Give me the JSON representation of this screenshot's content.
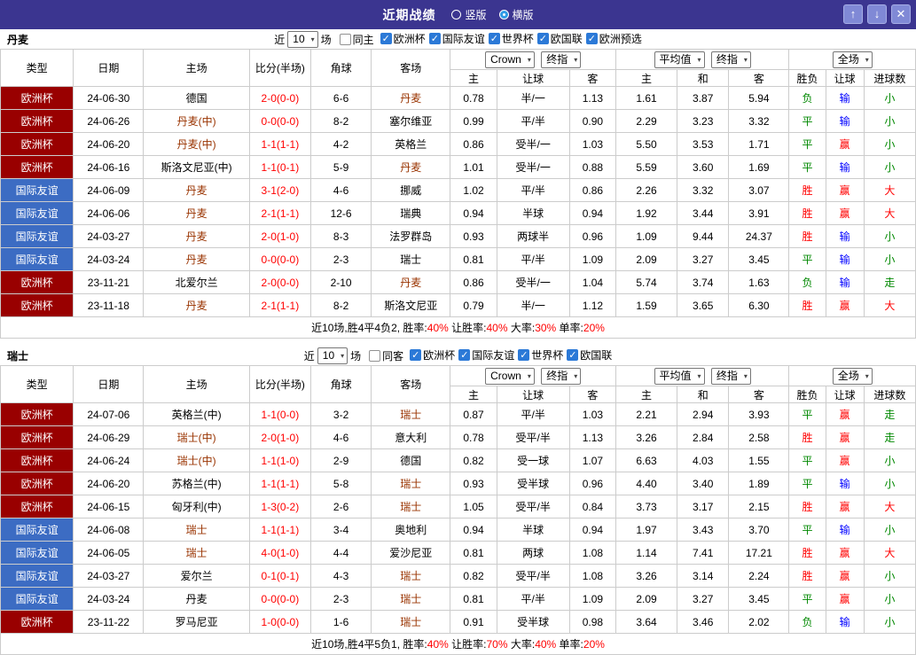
{
  "titlebar": {
    "title": "近期战绩",
    "view_options": [
      {
        "label": "竖版",
        "selected": false
      },
      {
        "label": "横版",
        "selected": true
      }
    ],
    "buttons": {
      "up": "↑",
      "down": "↓",
      "close": "✕"
    }
  },
  "icons": {
    "chevron": "▾"
  },
  "colors": {
    "titlebar_bg": "#3b3590",
    "euro_bg": "#990000",
    "friendly_bg": "#3c6cc3",
    "score": "#ff0000",
    "team_highlight": "#993300",
    "win": "#ff0000",
    "draw": "#008800",
    "loss": "#008800",
    "cover": "#ff0000",
    "not_cover": "#0000ff",
    "over": "#ff0000",
    "under": "#008800",
    "push": "#008800",
    "summary_value": "#ff0000",
    "checkbox_checked": "#2b79d7"
  },
  "table_headers": {
    "type": "类型",
    "date": "日期",
    "home": "主场",
    "score": "比分(半场)",
    "corner": "角球",
    "away": "客场",
    "odds_home": "主",
    "odds_handicap": "让球",
    "odds_away": "客",
    "avg_home": "主",
    "avg_draw": "和",
    "avg_away": "客",
    "result": "胜负",
    "handicap": "让球",
    "goals": "进球数",
    "bookmaker": "Crown",
    "final_index": "终指",
    "average": "平均值",
    "final_index2": "终指",
    "fulltime": "全场"
  },
  "sections": [
    {
      "team": "丹麦",
      "filter": {
        "near": "近",
        "count": "10",
        "games": "场",
        "same": "同主",
        "same_checked": false,
        "competitions": [
          "欧洲杯",
          "国际友谊",
          "世界杯",
          "欧国联",
          "欧洲预选"
        ]
      },
      "rows": [
        {
          "type": "欧洲杯",
          "tk": "euro",
          "date": "24-06-30",
          "home": "德国",
          "hh": false,
          "score": "2-0(0-0)",
          "corner": "6-6",
          "away": "丹麦",
          "ah": true,
          "o1": "0.78",
          "hcp": "半/一",
          "o2": "1.13",
          "a1": "1.61",
          "a2": "3.87",
          "a3": "5.94",
          "res": "负",
          "hres": "输",
          "gres": "小"
        },
        {
          "type": "欧洲杯",
          "tk": "euro",
          "date": "24-06-26",
          "home": "丹麦(中)",
          "hh": true,
          "score": "0-0(0-0)",
          "corner": "8-2",
          "away": "塞尔维亚",
          "ah": false,
          "o1": "0.99",
          "hcp": "平/半",
          "o2": "0.90",
          "a1": "2.29",
          "a2": "3.23",
          "a3": "3.32",
          "res": "平",
          "hres": "输",
          "gres": "小"
        },
        {
          "type": "欧洲杯",
          "tk": "euro",
          "date": "24-06-20",
          "home": "丹麦(中)",
          "hh": true,
          "score": "1-1(1-1)",
          "corner": "4-2",
          "away": "英格兰",
          "ah": false,
          "o1": "0.86",
          "hcp": "受半/一",
          "o2": "1.03",
          "a1": "5.50",
          "a2": "3.53",
          "a3": "1.71",
          "res": "平",
          "hres": "赢",
          "gres": "小"
        },
        {
          "type": "欧洲杯",
          "tk": "euro",
          "date": "24-06-16",
          "home": "斯洛文尼亚(中)",
          "hh": false,
          "score": "1-1(0-1)",
          "corner": "5-9",
          "away": "丹麦",
          "ah": true,
          "o1": "1.01",
          "hcp": "受半/一",
          "o2": "0.88",
          "a1": "5.59",
          "a2": "3.60",
          "a3": "1.69",
          "res": "平",
          "hres": "输",
          "gres": "小"
        },
        {
          "type": "国际友谊",
          "tk": "friendly",
          "date": "24-06-09",
          "home": "丹麦",
          "hh": true,
          "score": "3-1(2-0)",
          "corner": "4-6",
          "away": "挪威",
          "ah": false,
          "o1": "1.02",
          "hcp": "平/半",
          "o2": "0.86",
          "a1": "2.26",
          "a2": "3.32",
          "a3": "3.07",
          "res": "胜",
          "hres": "赢",
          "gres": "大"
        },
        {
          "type": "国际友谊",
          "tk": "friendly",
          "date": "24-06-06",
          "home": "丹麦",
          "hh": true,
          "score": "2-1(1-1)",
          "corner": "12-6",
          "away": "瑞典",
          "ah": false,
          "o1": "0.94",
          "hcp": "半球",
          "o2": "0.94",
          "a1": "1.92",
          "a2": "3.44",
          "a3": "3.91",
          "res": "胜",
          "hres": "赢",
          "gres": "大"
        },
        {
          "type": "国际友谊",
          "tk": "friendly",
          "date": "24-03-27",
          "home": "丹麦",
          "hh": true,
          "score": "2-0(1-0)",
          "corner": "8-3",
          "away": "法罗群岛",
          "ah": false,
          "o1": "0.93",
          "hcp": "两球半",
          "o2": "0.96",
          "a1": "1.09",
          "a2": "9.44",
          "a3": "24.37",
          "res": "胜",
          "hres": "输",
          "gres": "小"
        },
        {
          "type": "国际友谊",
          "tk": "friendly",
          "date": "24-03-24",
          "home": "丹麦",
          "hh": true,
          "score": "0-0(0-0)",
          "corner": "2-3",
          "away": "瑞士",
          "ah": false,
          "o1": "0.81",
          "hcp": "平/半",
          "o2": "1.09",
          "a1": "2.09",
          "a2": "3.27",
          "a3": "3.45",
          "res": "平",
          "hres": "输",
          "gres": "小"
        },
        {
          "type": "欧洲杯",
          "tk": "euro",
          "date": "23-11-21",
          "home": "北爱尔兰",
          "hh": false,
          "score": "2-0(0-0)",
          "corner": "2-10",
          "away": "丹麦",
          "ah": true,
          "o1": "0.86",
          "hcp": "受半/一",
          "o2": "1.04",
          "a1": "5.74",
          "a2": "3.74",
          "a3": "1.63",
          "res": "负",
          "hres": "输",
          "gres": "走"
        },
        {
          "type": "欧洲杯",
          "tk": "euro",
          "date": "23-11-18",
          "home": "丹麦",
          "hh": true,
          "score": "2-1(1-1)",
          "corner": "8-2",
          "away": "斯洛文尼亚",
          "ah": false,
          "o1": "0.79",
          "hcp": "半/一",
          "o2": "1.12",
          "a1": "1.59",
          "a2": "3.65",
          "a3": "6.30",
          "res": "胜",
          "hres": "赢",
          "gres": "大"
        }
      ],
      "summary": [
        {
          "text": "近10场,胜4平4负2, 胜率:",
          "red": false
        },
        {
          "text": "40%",
          "red": true
        },
        {
          "text": " 让胜率:",
          "red": false
        },
        {
          "text": "40%",
          "red": true
        },
        {
          "text": " 大率:",
          "red": false
        },
        {
          "text": "30%",
          "red": true
        },
        {
          "text": " 单率:",
          "red": false
        },
        {
          "text": "20%",
          "red": true
        }
      ]
    },
    {
      "team": "瑞士",
      "filter": {
        "near": "近",
        "count": "10",
        "games": "场",
        "same": "同客",
        "same_checked": false,
        "competitions": [
          "欧洲杯",
          "国际友谊",
          "世界杯",
          "欧国联"
        ]
      },
      "rows": [
        {
          "type": "欧洲杯",
          "tk": "euro",
          "date": "24-07-06",
          "home": "英格兰(中)",
          "hh": false,
          "score": "1-1(0-0)",
          "corner": "3-2",
          "away": "瑞士",
          "ah": true,
          "o1": "0.87",
          "hcp": "平/半",
          "o2": "1.03",
          "a1": "2.21",
          "a2": "2.94",
          "a3": "3.93",
          "res": "平",
          "hres": "赢",
          "gres": "走"
        },
        {
          "type": "欧洲杯",
          "tk": "euro",
          "date": "24-06-29",
          "home": "瑞士(中)",
          "hh": true,
          "score": "2-0(1-0)",
          "corner": "4-6",
          "away": "意大利",
          "ah": false,
          "o1": "0.78",
          "hcp": "受平/半",
          "o2": "1.13",
          "a1": "3.26",
          "a2": "2.84",
          "a3": "2.58",
          "res": "胜",
          "hres": "赢",
          "gres": "走"
        },
        {
          "type": "欧洲杯",
          "tk": "euro",
          "date": "24-06-24",
          "home": "瑞士(中)",
          "hh": true,
          "score": "1-1(1-0)",
          "corner": "2-9",
          "away": "德国",
          "ah": false,
          "o1": "0.82",
          "hcp": "受一球",
          "o2": "1.07",
          "a1": "6.63",
          "a2": "4.03",
          "a3": "1.55",
          "res": "平",
          "hres": "赢",
          "gres": "小"
        },
        {
          "type": "欧洲杯",
          "tk": "euro",
          "date": "24-06-20",
          "home": "苏格兰(中)",
          "hh": false,
          "score": "1-1(1-1)",
          "corner": "5-8",
          "away": "瑞士",
          "ah": true,
          "o1": "0.93",
          "hcp": "受半球",
          "o2": "0.96",
          "a1": "4.40",
          "a2": "3.40",
          "a3": "1.89",
          "res": "平",
          "hres": "输",
          "gres": "小"
        },
        {
          "type": "欧洲杯",
          "tk": "euro",
          "date": "24-06-15",
          "home": "匈牙利(中)",
          "hh": false,
          "score": "1-3(0-2)",
          "corner": "2-6",
          "away": "瑞士",
          "ah": true,
          "o1": "1.05",
          "hcp": "受平/半",
          "o2": "0.84",
          "a1": "3.73",
          "a2": "3.17",
          "a3": "2.15",
          "res": "胜",
          "hres": "赢",
          "gres": "大"
        },
        {
          "type": "国际友谊",
          "tk": "friendly",
          "date": "24-06-08",
          "home": "瑞士",
          "hh": true,
          "score": "1-1(1-1)",
          "corner": "3-4",
          "away": "奥地利",
          "ah": false,
          "o1": "0.94",
          "hcp": "半球",
          "o2": "0.94",
          "a1": "1.97",
          "a2": "3.43",
          "a3": "3.70",
          "res": "平",
          "hres": "输",
          "gres": "小"
        },
        {
          "type": "国际友谊",
          "tk": "friendly",
          "date": "24-06-05",
          "home": "瑞士",
          "hh": true,
          "score": "4-0(1-0)",
          "corner": "4-4",
          "away": "爱沙尼亚",
          "ah": false,
          "o1": "0.81",
          "hcp": "两球",
          "o2": "1.08",
          "a1": "1.14",
          "a2": "7.41",
          "a3": "17.21",
          "res": "胜",
          "hres": "赢",
          "gres": "大"
        },
        {
          "type": "国际友谊",
          "tk": "friendly",
          "date": "24-03-27",
          "home": "爱尔兰",
          "hh": false,
          "score": "0-1(0-1)",
          "corner": "4-3",
          "away": "瑞士",
          "ah": true,
          "o1": "0.82",
          "hcp": "受平/半",
          "o2": "1.08",
          "a1": "3.26",
          "a2": "3.14",
          "a3": "2.24",
          "res": "胜",
          "hres": "赢",
          "gres": "小"
        },
        {
          "type": "国际友谊",
          "tk": "friendly",
          "date": "24-03-24",
          "home": "丹麦",
          "hh": false,
          "score": "0-0(0-0)",
          "corner": "2-3",
          "away": "瑞士",
          "ah": true,
          "o1": "0.81",
          "hcp": "平/半",
          "o2": "1.09",
          "a1": "2.09",
          "a2": "3.27",
          "a3": "3.45",
          "res": "平",
          "hres": "赢",
          "gres": "小"
        },
        {
          "type": "欧洲杯",
          "tk": "euro",
          "date": "23-11-22",
          "home": "罗马尼亚",
          "hh": false,
          "score": "1-0(0-0)",
          "corner": "1-6",
          "away": "瑞士",
          "ah": true,
          "o1": "0.91",
          "hcp": "受半球",
          "o2": "0.98",
          "a1": "3.64",
          "a2": "3.46",
          "a3": "2.02",
          "res": "负",
          "hres": "输",
          "gres": "小"
        }
      ],
      "summary": [
        {
          "text": "近10场,胜4平5负1, 胜率:",
          "red": false
        },
        {
          "text": "40%",
          "red": true
        },
        {
          "text": " 让胜率:",
          "red": false
        },
        {
          "text": "70%",
          "red": true
        },
        {
          "text": " 大率:",
          "red": false
        },
        {
          "text": "40%",
          "red": true
        },
        {
          "text": " 单率:",
          "red": false
        },
        {
          "text": "20%",
          "red": true
        }
      ]
    }
  ]
}
